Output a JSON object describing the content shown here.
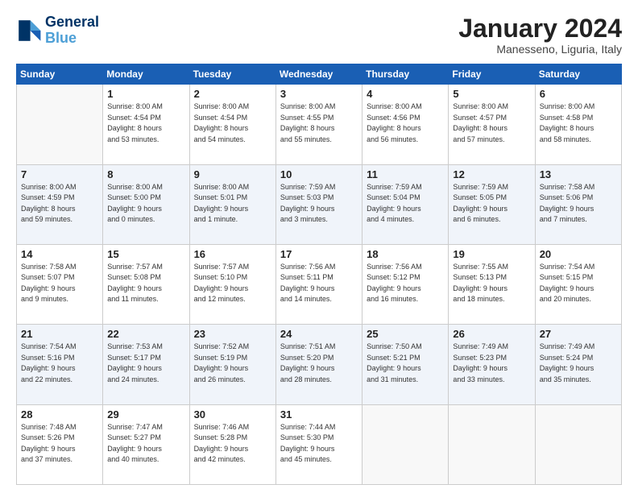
{
  "header": {
    "logo_line1": "General",
    "logo_line2": "Blue",
    "month": "January 2024",
    "location": "Manesseno, Liguria, Italy"
  },
  "weekdays": [
    "Sunday",
    "Monday",
    "Tuesday",
    "Wednesday",
    "Thursday",
    "Friday",
    "Saturday"
  ],
  "weeks": [
    [
      {
        "day": "",
        "info": ""
      },
      {
        "day": "1",
        "info": "Sunrise: 8:00 AM\nSunset: 4:54 PM\nDaylight: 8 hours\nand 53 minutes."
      },
      {
        "day": "2",
        "info": "Sunrise: 8:00 AM\nSunset: 4:54 PM\nDaylight: 8 hours\nand 54 minutes."
      },
      {
        "day": "3",
        "info": "Sunrise: 8:00 AM\nSunset: 4:55 PM\nDaylight: 8 hours\nand 55 minutes."
      },
      {
        "day": "4",
        "info": "Sunrise: 8:00 AM\nSunset: 4:56 PM\nDaylight: 8 hours\nand 56 minutes."
      },
      {
        "day": "5",
        "info": "Sunrise: 8:00 AM\nSunset: 4:57 PM\nDaylight: 8 hours\nand 57 minutes."
      },
      {
        "day": "6",
        "info": "Sunrise: 8:00 AM\nSunset: 4:58 PM\nDaylight: 8 hours\nand 58 minutes."
      }
    ],
    [
      {
        "day": "7",
        "info": "Sunrise: 8:00 AM\nSunset: 4:59 PM\nDaylight: 8 hours\nand 59 minutes."
      },
      {
        "day": "8",
        "info": "Sunrise: 8:00 AM\nSunset: 5:00 PM\nDaylight: 9 hours\nand 0 minutes."
      },
      {
        "day": "9",
        "info": "Sunrise: 8:00 AM\nSunset: 5:01 PM\nDaylight: 9 hours\nand 1 minute."
      },
      {
        "day": "10",
        "info": "Sunrise: 7:59 AM\nSunset: 5:03 PM\nDaylight: 9 hours\nand 3 minutes."
      },
      {
        "day": "11",
        "info": "Sunrise: 7:59 AM\nSunset: 5:04 PM\nDaylight: 9 hours\nand 4 minutes."
      },
      {
        "day": "12",
        "info": "Sunrise: 7:59 AM\nSunset: 5:05 PM\nDaylight: 9 hours\nand 6 minutes."
      },
      {
        "day": "13",
        "info": "Sunrise: 7:58 AM\nSunset: 5:06 PM\nDaylight: 9 hours\nand 7 minutes."
      }
    ],
    [
      {
        "day": "14",
        "info": "Sunrise: 7:58 AM\nSunset: 5:07 PM\nDaylight: 9 hours\nand 9 minutes."
      },
      {
        "day": "15",
        "info": "Sunrise: 7:57 AM\nSunset: 5:08 PM\nDaylight: 9 hours\nand 11 minutes."
      },
      {
        "day": "16",
        "info": "Sunrise: 7:57 AM\nSunset: 5:10 PM\nDaylight: 9 hours\nand 12 minutes."
      },
      {
        "day": "17",
        "info": "Sunrise: 7:56 AM\nSunset: 5:11 PM\nDaylight: 9 hours\nand 14 minutes."
      },
      {
        "day": "18",
        "info": "Sunrise: 7:56 AM\nSunset: 5:12 PM\nDaylight: 9 hours\nand 16 minutes."
      },
      {
        "day": "19",
        "info": "Sunrise: 7:55 AM\nSunset: 5:13 PM\nDaylight: 9 hours\nand 18 minutes."
      },
      {
        "day": "20",
        "info": "Sunrise: 7:54 AM\nSunset: 5:15 PM\nDaylight: 9 hours\nand 20 minutes."
      }
    ],
    [
      {
        "day": "21",
        "info": "Sunrise: 7:54 AM\nSunset: 5:16 PM\nDaylight: 9 hours\nand 22 minutes."
      },
      {
        "day": "22",
        "info": "Sunrise: 7:53 AM\nSunset: 5:17 PM\nDaylight: 9 hours\nand 24 minutes."
      },
      {
        "day": "23",
        "info": "Sunrise: 7:52 AM\nSunset: 5:19 PM\nDaylight: 9 hours\nand 26 minutes."
      },
      {
        "day": "24",
        "info": "Sunrise: 7:51 AM\nSunset: 5:20 PM\nDaylight: 9 hours\nand 28 minutes."
      },
      {
        "day": "25",
        "info": "Sunrise: 7:50 AM\nSunset: 5:21 PM\nDaylight: 9 hours\nand 31 minutes."
      },
      {
        "day": "26",
        "info": "Sunrise: 7:49 AM\nSunset: 5:23 PM\nDaylight: 9 hours\nand 33 minutes."
      },
      {
        "day": "27",
        "info": "Sunrise: 7:49 AM\nSunset: 5:24 PM\nDaylight: 9 hours\nand 35 minutes."
      }
    ],
    [
      {
        "day": "28",
        "info": "Sunrise: 7:48 AM\nSunset: 5:26 PM\nDaylight: 9 hours\nand 37 minutes."
      },
      {
        "day": "29",
        "info": "Sunrise: 7:47 AM\nSunset: 5:27 PM\nDaylight: 9 hours\nand 40 minutes."
      },
      {
        "day": "30",
        "info": "Sunrise: 7:46 AM\nSunset: 5:28 PM\nDaylight: 9 hours\nand 42 minutes."
      },
      {
        "day": "31",
        "info": "Sunrise: 7:44 AM\nSunset: 5:30 PM\nDaylight: 9 hours\nand 45 minutes."
      },
      {
        "day": "",
        "info": ""
      },
      {
        "day": "",
        "info": ""
      },
      {
        "day": "",
        "info": ""
      }
    ]
  ]
}
